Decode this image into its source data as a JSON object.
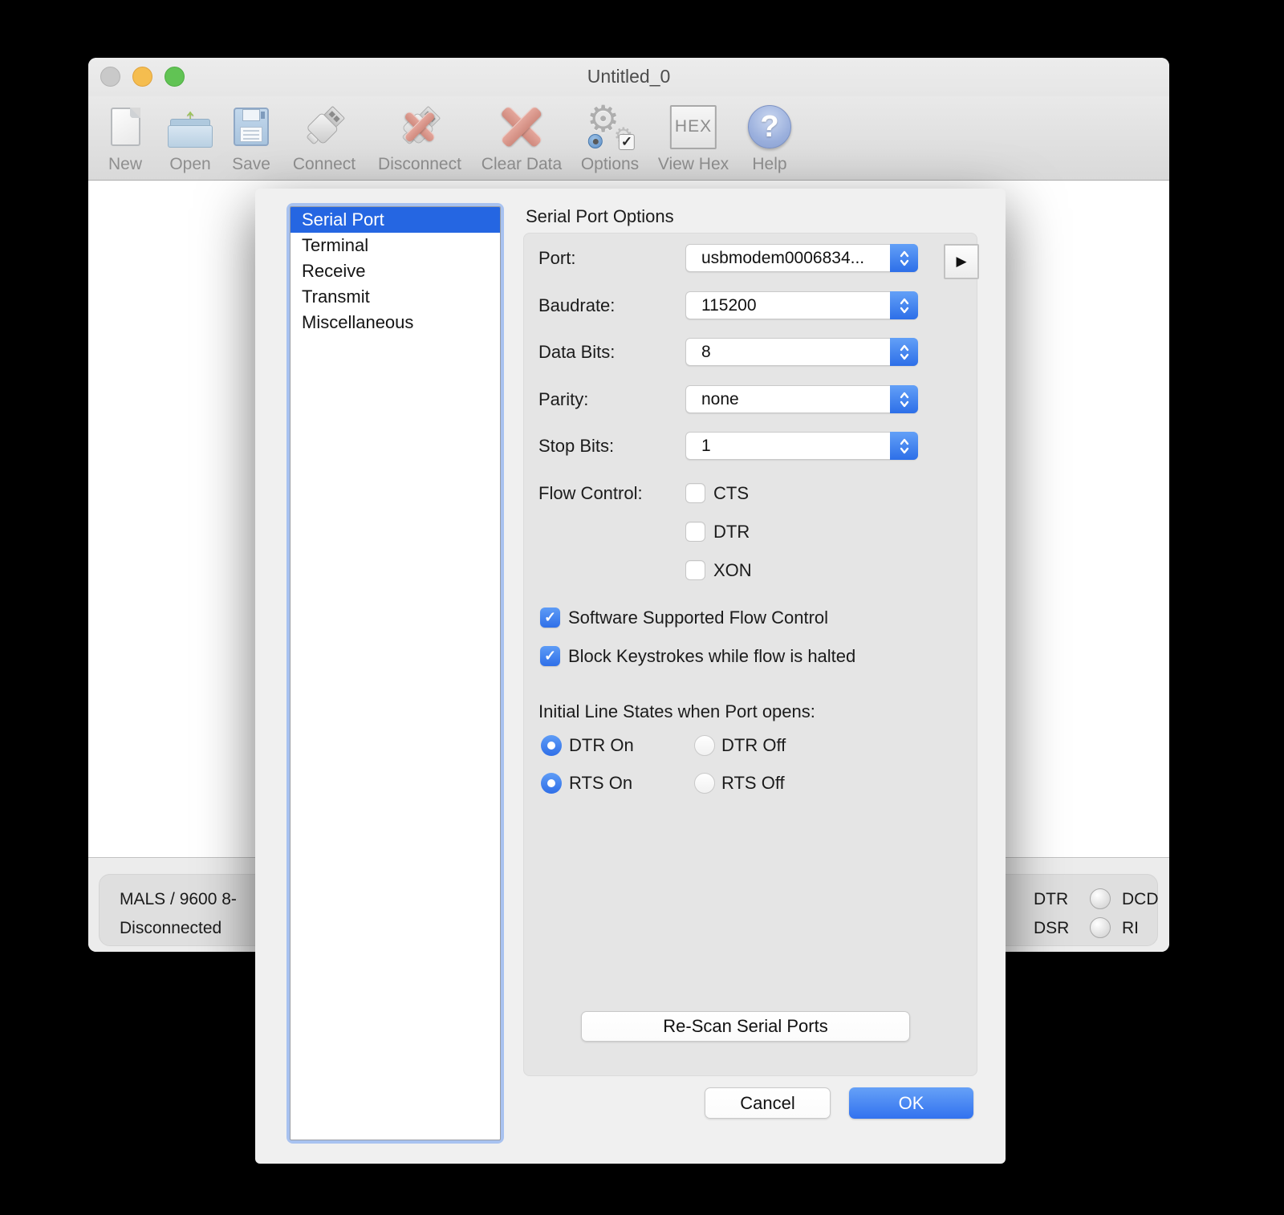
{
  "window": {
    "title": "Untitled_0",
    "toolbar": [
      {
        "label": "New"
      },
      {
        "label": "Open"
      },
      {
        "label": "Save"
      },
      {
        "label": "Connect"
      },
      {
        "label": "Disconnect"
      },
      {
        "label": "Clear Data"
      },
      {
        "label": "Options"
      },
      {
        "label": "View Hex",
        "hex_badge": "HEX"
      },
      {
        "label": "Help",
        "glyph": "?"
      }
    ],
    "status_bar": {
      "line1": "MALS / 9600 8-",
      "line2": "Disconnected",
      "indicators": [
        {
          "left": "DTR",
          "right": "DCD"
        },
        {
          "left": "DSR",
          "right": "RI"
        }
      ]
    }
  },
  "dialog": {
    "sidebar": {
      "items": [
        {
          "label": "Serial Port",
          "selected": true
        },
        {
          "label": "Terminal",
          "selected": false
        },
        {
          "label": "Receive",
          "selected": false
        },
        {
          "label": "Transmit",
          "selected": false
        },
        {
          "label": "Miscellaneous",
          "selected": false
        }
      ]
    },
    "title": "Serial Port Options",
    "fields": [
      {
        "label": "Port:",
        "value": "usbmodem0006834..."
      },
      {
        "label": "Baudrate:",
        "value": "115200"
      },
      {
        "label": "Data Bits:",
        "value": "8"
      },
      {
        "label": "Parity:",
        "value": "none"
      },
      {
        "label": "Stop Bits:",
        "value": "1"
      }
    ],
    "flow_control": {
      "label": "Flow Control:",
      "options": [
        {
          "label": "CTS",
          "checked": false
        },
        {
          "label": "DTR",
          "checked": false
        },
        {
          "label": "XON",
          "checked": false
        }
      ]
    },
    "checkboxes": [
      {
        "label": "Software Supported Flow Control",
        "checked": true
      },
      {
        "label": "Block Keystrokes while flow is halted",
        "checked": true
      }
    ],
    "initial_line_states": {
      "label": "Initial Line States when Port opens:",
      "radios": [
        {
          "label": "DTR On",
          "selected": true
        },
        {
          "label": "DTR Off",
          "selected": false
        },
        {
          "label": "RTS On",
          "selected": true
        },
        {
          "label": "RTS Off",
          "selected": false
        }
      ]
    },
    "buttons": {
      "rescan": "Re-Scan Serial Ports",
      "cancel": "Cancel",
      "ok": "OK"
    },
    "checkmark": "✓"
  },
  "colors": {
    "accent_blue": "#2F6FE8",
    "selection_blue": "#2566E2",
    "clear_x_red": "#D98F83",
    "led_gray": "#DADADA"
  }
}
